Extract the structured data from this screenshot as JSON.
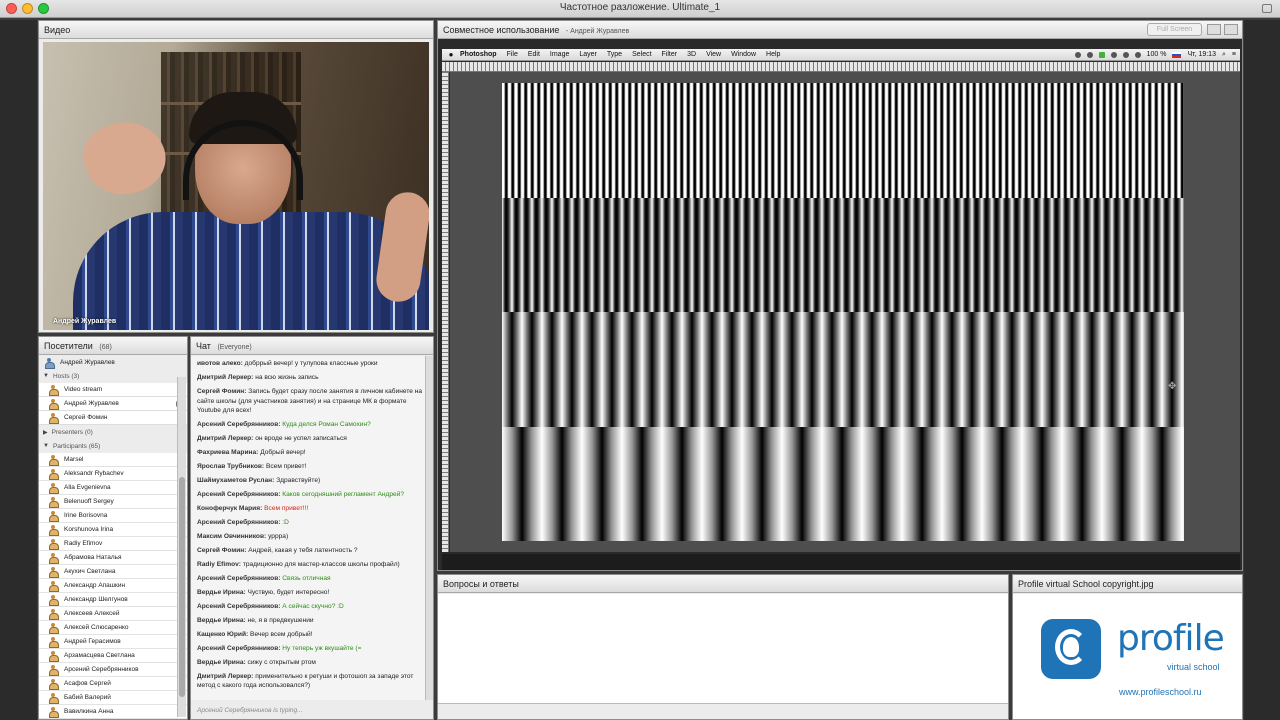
{
  "window": {
    "title": "Частотное разложение. Ultimate_1",
    "colors": {
      "close": "#fd5f57",
      "minimize": "#febc2e",
      "zoom": "#28c840"
    }
  },
  "video": {
    "title": "Видео",
    "presenter_name": "Андрей Журавлев"
  },
  "attendees": {
    "title": "Посетители",
    "count": "(68)",
    "me": "Андрей Журавлев",
    "hosts_label": "Hosts (3)",
    "hosts": [
      "Video stream",
      "Андрей Журавлев",
      "Сергей Фомин"
    ],
    "presenters_label": "Presenters (0)",
    "participants_label": "Participants (65)",
    "participants": [
      "Marsel",
      "Aleksandr Rybachev",
      "Alla Evgenievna",
      "Belenuoff Sergey",
      "Irine Borisovna",
      "Korshunova Irina",
      "Radiy Efimov",
      "Абрамова Наталья",
      "Акухич Светлана",
      "Александр Апашкин",
      "Александр Шелгунов",
      "Алексеев Алексей",
      "Алексей Слюсаренко",
      "Андрей Герасимов",
      "Арзамасцева Светлана",
      "Арсений Серебрянников",
      "Асафов Сергей",
      "Бабий Валерий",
      "Вавилкина Анна"
    ]
  },
  "chat": {
    "title": "Чат",
    "scope": "(Everyone)",
    "typing": "Арсений Серебрянников is typing...",
    "messages": [
      {
        "who": "ивотов алеко:",
        "text": "добррый вечер! у тулупова классные уроки",
        "style": "normal"
      },
      {
        "who": "Дмитрий Леркер:",
        "text": "на всю жизнь запись",
        "style": "normal"
      },
      {
        "who": "Сергей Фомин:",
        "text": "Запись будет сразу после занятия в личном кабинете на сайте школы (для участников занятия) и на странице МК в формате Youtube для всех!",
        "style": "normal"
      },
      {
        "who": "Арсений Серебрянников:",
        "text": "Куда делся Роман Самохин?",
        "style": "green"
      },
      {
        "who": "Дмитрий Леркер:",
        "text": "он вроде не успел записаться",
        "style": "normal"
      },
      {
        "who": "Фахриева Марина:",
        "text": "Добрый вечер!",
        "style": "normal"
      },
      {
        "who": "Ярослав Трубников:",
        "text": "Всем привет!",
        "style": "normal"
      },
      {
        "who": "Шаймухаметов Руслан:",
        "text": "Здравствуйте)",
        "style": "normal"
      },
      {
        "who": "Арсений Серебрянников:",
        "text": "Каков сегодняшний регламент Андрей?",
        "style": "green"
      },
      {
        "who": "Коноферчук Мария:",
        "text": "Всем привет!!!",
        "style": "red"
      },
      {
        "who": "Арсений Серебрянников:",
        "text": ":D",
        "style": "green"
      },
      {
        "who": "Максим Овчинников:",
        "text": "уррра)",
        "style": "normal"
      },
      {
        "who": "Сергей Фомин:",
        "text": "Андрей, какая у тебя латентность ?",
        "style": "normal"
      },
      {
        "who": "Radiy Efimov:",
        "text": "традиционно для мастер-классов школы профайл)",
        "style": "normal"
      },
      {
        "who": "Арсений Серебрянников:",
        "text": "Связь отличная",
        "style": "green"
      },
      {
        "who": "Вердье Ирина:",
        "text": "Чуствую, будет интересно!",
        "style": "normal"
      },
      {
        "who": "Арсений Серебрянников:",
        "text": "А сейчас скучно? :D",
        "style": "green"
      },
      {
        "who": "Вердье Ирина:",
        "text": "не, я в предвкушении",
        "style": "normal"
      },
      {
        "who": "Кащенко Юрий:",
        "text": "Вечер всем добрый!",
        "style": "normal"
      },
      {
        "who": "Арсений Серебрянников:",
        "text": "Ну теперь уж вкушайте (=",
        "style": "green"
      },
      {
        "who": "Вердье Ирина:",
        "text": "сижу с открытым ртом",
        "style": "normal"
      },
      {
        "who": "Дмитрий Леркер:",
        "text": "применительно к ретуши и фотошоп за западе этот метод с какого года использовался?)",
        "style": "normal"
      }
    ]
  },
  "share": {
    "title": "Совместное использование",
    "presenter": "- Андрей Журавлев",
    "fullscreen_label": "Full Screen",
    "photoshop": {
      "apple": "",
      "app": "Photoshop",
      "menu": [
        "File",
        "Edit",
        "Image",
        "Layer",
        "Type",
        "Select",
        "Filter",
        "3D",
        "View",
        "Window",
        "Help"
      ],
      "battery": "100 %",
      "clock": "Чт, 19:13"
    }
  },
  "qa": {
    "title": "Вопросы и ответы"
  },
  "file_pod": {
    "title": "Profile virtual School copyright.jpg",
    "logo_word": "profile",
    "logo_sub": "virtual school",
    "logo_url": "www.profileschool.ru"
  }
}
